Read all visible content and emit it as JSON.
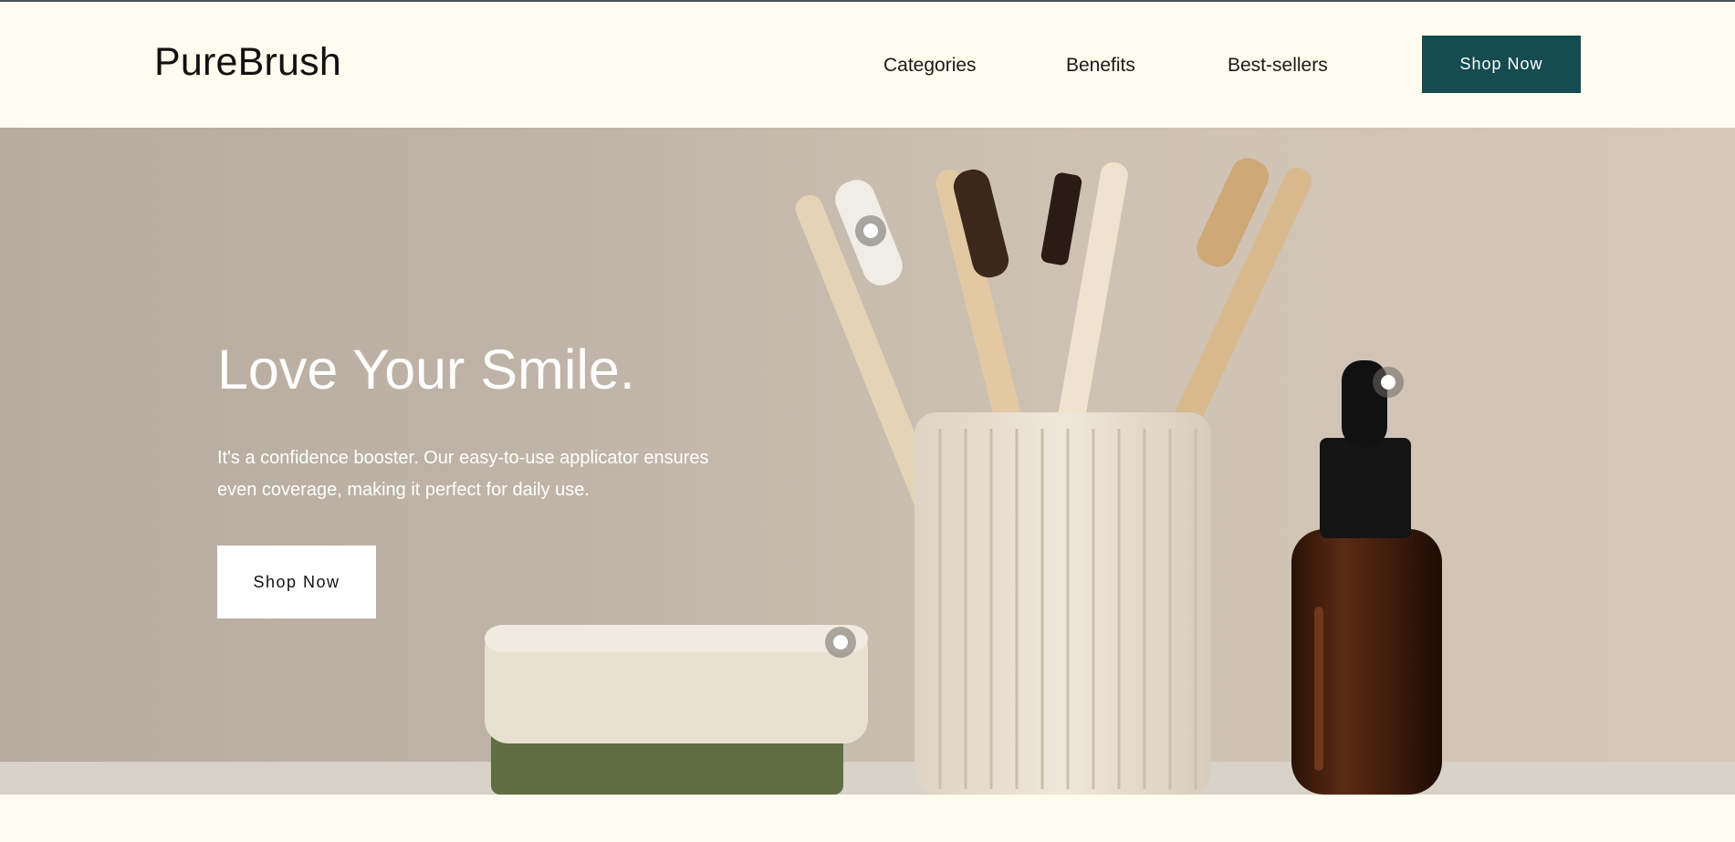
{
  "header": {
    "logo": "PureBrush",
    "nav": [
      "Categories",
      "Benefits",
      "Best-sellers"
    ],
    "cta_label": "Shop Now",
    "cta_color": "#164b50"
  },
  "hero": {
    "title": "Love Your Smile.",
    "subtitle": "It's a confidence booster. Our easy-to-use applicator ensures even coverage, making it perfect for daily use.",
    "cta_label": "Shop Now",
    "hotspot_icons": [
      "hotspot-toothbrush-icon",
      "hotspot-dropper-icon",
      "hotspot-soap-icon"
    ]
  },
  "colors": {
    "background": "#fefcee",
    "accent": "#164b50",
    "hero_text": "#ffffff"
  }
}
